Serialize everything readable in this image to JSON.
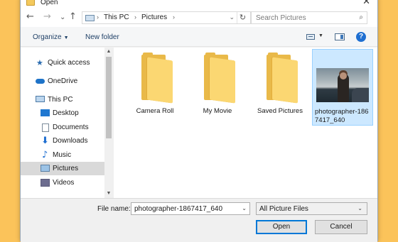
{
  "window": {
    "title": "Open",
    "close_glyph": "✕"
  },
  "nav": {
    "back_glyph": "←",
    "forward_glyph": "→",
    "recent_glyph": "⌄",
    "up_glyph": "↑",
    "breadcrumb": [
      "This PC",
      "Pictures"
    ],
    "crumb_sep": "›",
    "address_dropdown_glyph": "⌄",
    "refresh_glyph": "↻",
    "search_placeholder": "Search Pictures",
    "search_glyph": "⌕"
  },
  "toolbar": {
    "organize_label": "Organize",
    "organize_caret": "▼",
    "new_folder_label": "New folder",
    "view_dd_glyph": "▼",
    "help_label": "?"
  },
  "sidebar": {
    "items": [
      {
        "label": "Quick access",
        "icon": "star-icon"
      },
      {
        "label": "OneDrive",
        "icon": "cloud-icon"
      },
      {
        "label": "This PC",
        "icon": "computer-icon"
      },
      {
        "label": "Desktop",
        "icon": "desktop-icon"
      },
      {
        "label": "Documents",
        "icon": "documents-icon"
      },
      {
        "label": "Downloads",
        "icon": "download-icon"
      },
      {
        "label": "Music",
        "icon": "music-icon"
      },
      {
        "label": "Pictures",
        "icon": "pictures-icon",
        "selected": true
      },
      {
        "label": "Videos",
        "icon": "videos-icon"
      }
    ],
    "scroll_up_glyph": "▲",
    "scroll_down_glyph": "▼"
  },
  "files": [
    {
      "name": "Camera Roll",
      "type": "folder"
    },
    {
      "name": "My Movie",
      "type": "folder"
    },
    {
      "name": "Saved Pictures",
      "type": "folder"
    },
    {
      "name": "photographer-1867417_640",
      "type": "image",
      "selected": true
    }
  ],
  "footer": {
    "file_name_label": "File name:",
    "file_name_value": "photographer-1867417_640",
    "file_type_value": "All Picture Files",
    "dropdown_glyph": "⌄",
    "open_label": "Open",
    "cancel_label": "Cancel"
  },
  "colors": {
    "background": "#fbc35a",
    "accent": "#0078d7",
    "selection": "#cce8ff",
    "folder": "#fbd772"
  }
}
